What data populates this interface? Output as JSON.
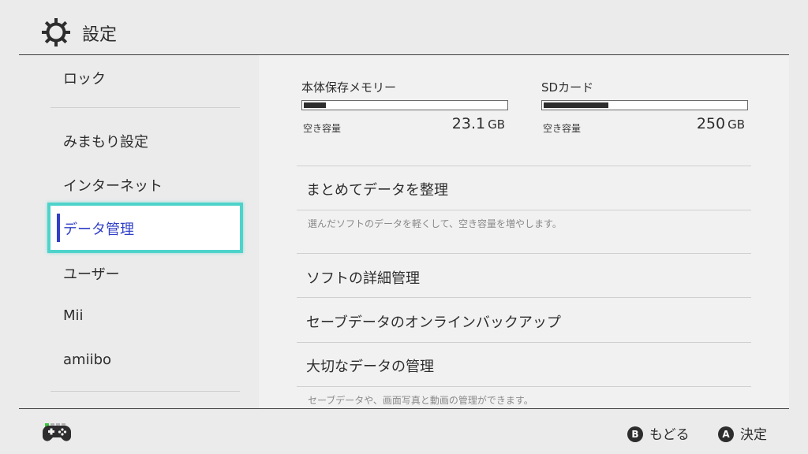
{
  "header": {
    "title": "設定",
    "icon": "gear-icon"
  },
  "sidebar": {
    "items": [
      {
        "label": "ロック"
      },
      {
        "label": "みまもり設定"
      },
      {
        "label": "インターネット"
      },
      {
        "label": "データ管理",
        "selected": true
      },
      {
        "label": "ユーザー"
      },
      {
        "label": "Mii"
      },
      {
        "label": "amiibo"
      }
    ]
  },
  "storage": {
    "system": {
      "name": "本体保存メモリー",
      "free_label": "空き容量",
      "amount": "23.1",
      "unit": "GB",
      "used_fraction": 0.11
    },
    "sd": {
      "name": "SDカード",
      "free_label": "空き容量",
      "amount": "250",
      "unit": "GB",
      "used_fraction": 0.32
    }
  },
  "main": {
    "items": [
      {
        "label": "まとめてデータを整理",
        "desc": "選んだソフトのデータを軽くして、空き容量を増やします。"
      },
      {
        "label": "ソフトの詳細管理"
      },
      {
        "label": "セーブデータのオンラインバックアップ"
      },
      {
        "label": "大切なデータの管理",
        "desc": "セーブデータや、画面写真と動画の管理ができます。"
      }
    ]
  },
  "footer": {
    "back": {
      "button": "B",
      "label": "もどる"
    },
    "ok": {
      "button": "A",
      "label": "決定"
    }
  },
  "colors": {
    "accent": "#3040c8",
    "selection_border": "#4ed3cb",
    "indicator_on": "#3cc83c"
  }
}
